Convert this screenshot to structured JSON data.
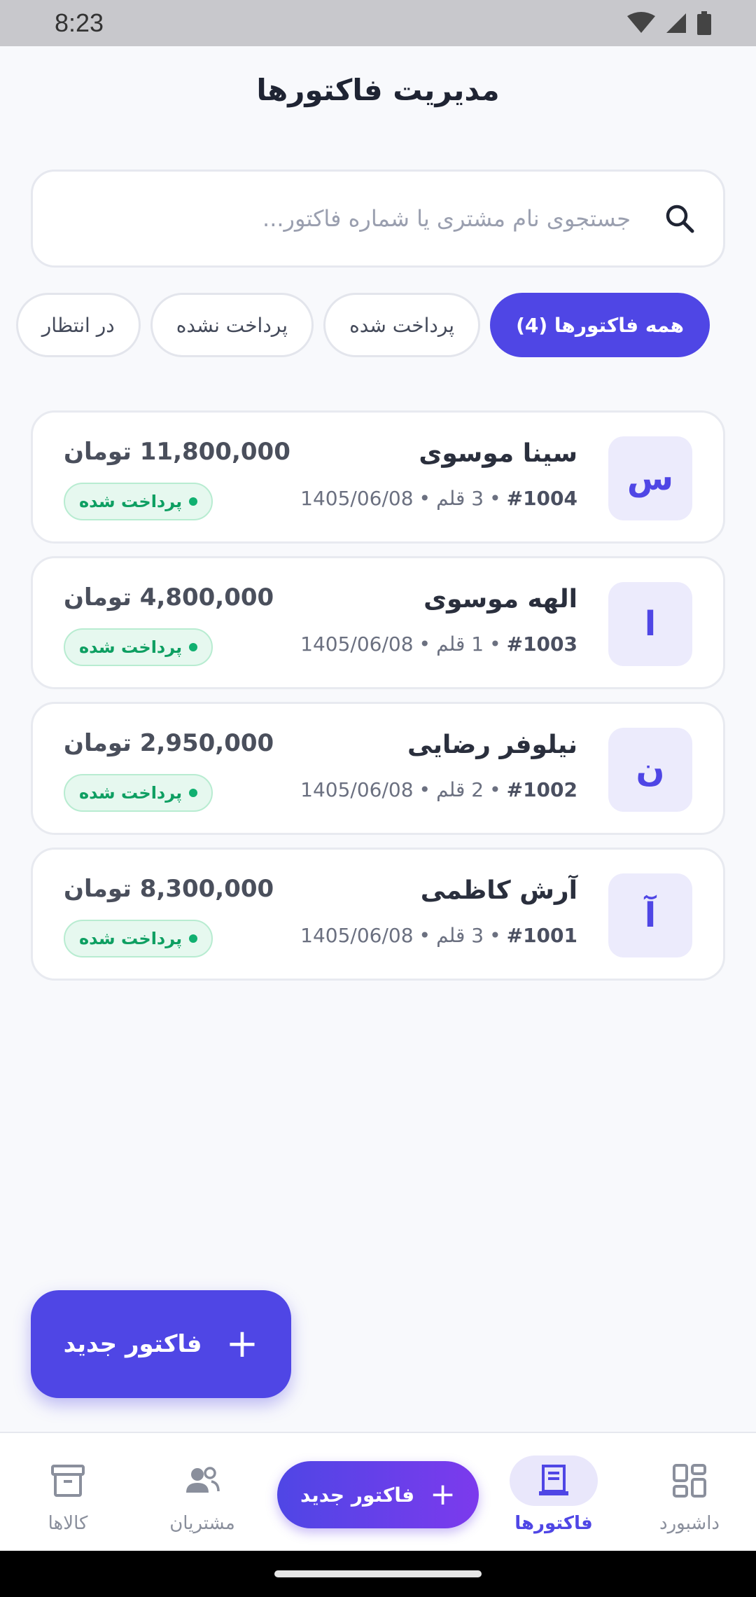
{
  "status_bar": {
    "time": "8:23"
  },
  "page": {
    "title": "مدیریت فاکتورها"
  },
  "search": {
    "placeholder": "جستجوی نام مشتری یا شماره فاکتور..."
  },
  "filters": [
    {
      "label": "همه فاکتورها (4)",
      "active": true
    },
    {
      "label": "پرداخت شده",
      "active": false
    },
    {
      "label": "پرداخت نشده",
      "active": false
    },
    {
      "label": "در انتظار",
      "active": false
    }
  ],
  "invoices": [
    {
      "initial": "س",
      "customer": "سینا موسوی",
      "number": "#1004",
      "items": "3 قلم",
      "date": "1405/06/08",
      "amount": "11,800,000 تومان",
      "status": "پرداخت شده"
    },
    {
      "initial": "ا",
      "customer": "الهه موسوی",
      "number": "#1003",
      "items": "1 قلم",
      "date": "1405/06/08",
      "amount": "4,800,000 تومان",
      "status": "پرداخت شده"
    },
    {
      "initial": "ن",
      "customer": "نیلوفر رضایی",
      "number": "#1002",
      "items": "2 قلم",
      "date": "1405/06/08",
      "amount": "2,950,000 تومان",
      "status": "پرداخت شده"
    },
    {
      "initial": "آ",
      "customer": "آرش کاظمی",
      "number": "#1001",
      "items": "3 قلم",
      "date": "1405/06/08",
      "amount": "8,300,000 تومان",
      "status": "پرداخت شده"
    }
  ],
  "fab": {
    "label": "فاکتور جدید"
  },
  "bottom_nav": {
    "dashboard": "داشبورد",
    "invoices": "فاکتورها",
    "new_invoice": "فاکتور جدید",
    "customers": "مشتریان",
    "products": "کالاها"
  },
  "colors": {
    "accent": "#4f46e5",
    "paid": "#0e9f62"
  }
}
